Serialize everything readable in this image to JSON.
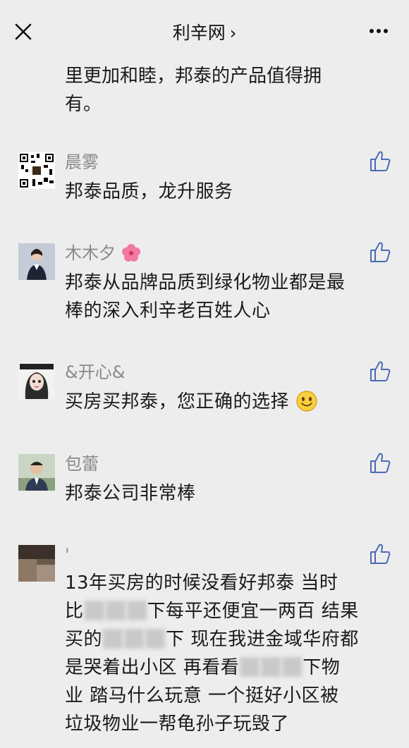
{
  "header": {
    "title": "利辛网",
    "chevron": "›",
    "close_icon": "close-icon",
    "more_icon": "more-icon"
  },
  "partial": {
    "lines": [
      "里更加和睦，邦泰的产品值得拥",
      "有。"
    ]
  },
  "comments": [
    {
      "nickname": "晨雾",
      "lines": [
        "邦泰品质，龙升服务"
      ]
    },
    {
      "nickname": "木木夕",
      "lines": [
        "邦泰从品牌品质到绿化物业都是最",
        "棒的深入利辛老百姓人心"
      ]
    },
    {
      "nickname": "&开心&",
      "lines": [
        "买房买邦泰，您正确的选择"
      ]
    },
    {
      "nickname": "包蕾",
      "lines": [
        "邦泰公司非常棒"
      ]
    },
    {
      "nickname": "'",
      "lines": [
        "13年买房的时候没看好邦泰  当时",
        "比",
        "下每平还便宜一两百  结果",
        "买的",
        "下  现在我进金域华府都",
        "是哭着出小区    再看看",
        "下物",
        "业  踏马什么玩意  一个挺好小区被",
        "垃圾物业一帮龟孙子玩毁了"
      ]
    }
  ]
}
